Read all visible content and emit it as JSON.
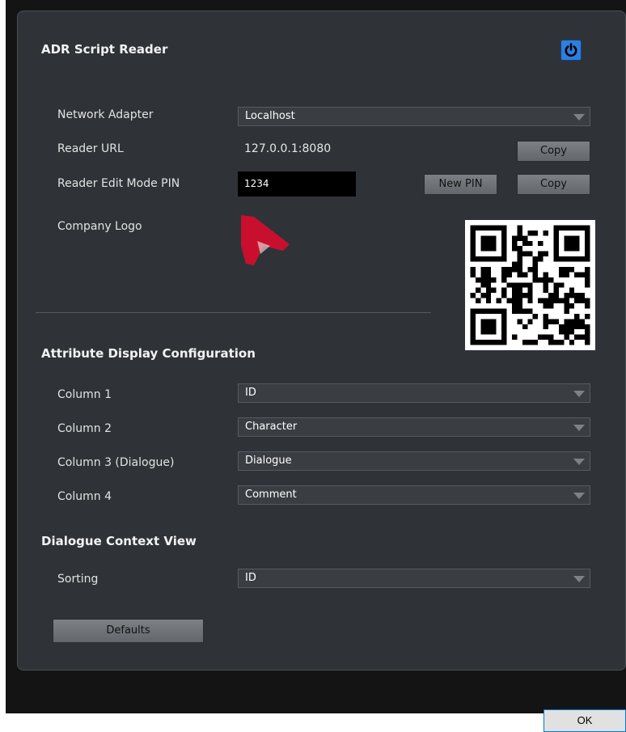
{
  "panel": {
    "title": "ADR Script Reader"
  },
  "network": {
    "adapter_label": "Network Adapter",
    "adapter_value": "Localhost",
    "url_label": "Reader URL",
    "url_value": "127.0.0.1:8080",
    "copy_url_label": "Copy",
    "pin_label": "Reader Edit Mode PIN",
    "pin_value": "1234",
    "new_pin_label": "New PIN",
    "copy_pin_label": "Copy",
    "logo_label": "Company Logo"
  },
  "attributes": {
    "title": "Attribute Display Configuration",
    "columns": [
      {
        "label": "Column 1",
        "value": "ID"
      },
      {
        "label": "Column 2",
        "value": "Character"
      },
      {
        "label": "Column 3 (Dialogue)",
        "value": "Dialogue"
      },
      {
        "label": "Column 4",
        "value": "Comment"
      }
    ]
  },
  "context": {
    "title": "Dialogue Context View",
    "sorting_label": "Sorting",
    "sorting_value": "ID"
  },
  "defaults_label": "Defaults",
  "ok_label": "OK",
  "icons": {
    "power": "power-icon",
    "logo": "company-logo",
    "qr": "qr-code",
    "dropdown": "chevron-down-icon"
  },
  "colors": {
    "accent": "#2c7fe0",
    "logo_red": "#c8102e",
    "panel_bg": "#2f3337",
    "window_bg": "#141414"
  }
}
